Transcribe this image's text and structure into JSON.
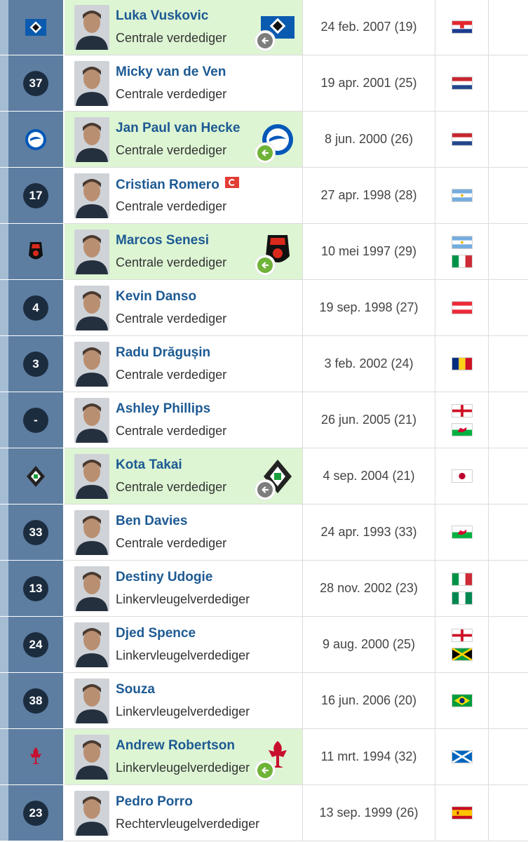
{
  "players": [
    {
      "num": "",
      "club_badge": "hamburg-badge",
      "name": "Luka Vuskovic",
      "position": "Centrale verdediger",
      "dob": "24 feb. 2007 (19)",
      "flags": [
        "croatia-flag"
      ],
      "loan": true,
      "loan_club": "hamburg-logo",
      "loan_arrow": "gray"
    },
    {
      "num": "37",
      "club_badge": "",
      "name": "Micky van de Ven",
      "position": "Centrale verdediger",
      "dob": "19 apr. 2001 (25)",
      "flags": [
        "netherlands-flag"
      ],
      "loan": false
    },
    {
      "num": "",
      "club_badge": "brighton-badge",
      "name": "Jan Paul van Hecke",
      "position": "Centrale verdediger",
      "dob": "8 jun. 2000 (26)",
      "flags": [
        "netherlands-flag"
      ],
      "loan": true,
      "loan_club": "brighton-logo",
      "loan_arrow": "green"
    },
    {
      "num": "17",
      "club_badge": "",
      "name": "Cristian Romero",
      "position": "Centrale verdediger",
      "dob": "27 apr. 1998 (28)",
      "flags": [
        "argentina-flag"
      ],
      "loan": false,
      "captain": true
    },
    {
      "num": "",
      "club_badge": "bournemouth-badge",
      "name": "Marcos Senesi",
      "position": "Centrale verdediger",
      "dob": "10 mei 1997 (29)",
      "flags": [
        "argentina-flag",
        "italy-flag"
      ],
      "loan": true,
      "loan_club": "bournemouth-logo",
      "loan_arrow": "green"
    },
    {
      "num": "4",
      "club_badge": "",
      "name": "Kevin Danso",
      "position": "Centrale verdediger",
      "dob": "19 sep. 1998 (27)",
      "flags": [
        "austria-flag"
      ],
      "loan": false
    },
    {
      "num": "3",
      "club_badge": "",
      "name": "Radu Drăgușin",
      "position": "Centrale verdediger",
      "dob": "3 feb. 2002 (24)",
      "flags": [
        "romania-flag"
      ],
      "loan": false
    },
    {
      "num": "-",
      "club_badge": "",
      "name": "Ashley Phillips",
      "position": "Centrale verdediger",
      "dob": "26 jun. 2005 (21)",
      "flags": [
        "england-flag",
        "wales-flag"
      ],
      "loan": false
    },
    {
      "num": "",
      "club_badge": "gladbach-badge",
      "name": "Kota Takai",
      "position": "Centrale verdediger",
      "dob": "4 sep. 2004 (21)",
      "flags": [
        "japan-flag"
      ],
      "loan": true,
      "loan_club": "gladbach-logo",
      "loan_arrow": "gray"
    },
    {
      "num": "33",
      "club_badge": "",
      "name": "Ben Davies",
      "position": "Centrale verdediger",
      "dob": "24 apr. 1993 (33)",
      "flags": [
        "wales-flag"
      ],
      "loan": false
    },
    {
      "num": "13",
      "club_badge": "",
      "name": "Destiny Udogie",
      "position": "Linkervleugelverdediger",
      "dob": "28 nov. 2002 (23)",
      "flags": [
        "italy-flag",
        "nigeria-flag"
      ],
      "loan": false
    },
    {
      "num": "24",
      "club_badge": "",
      "name": "Djed Spence",
      "position": "Linkervleugelverdediger",
      "dob": "9 aug. 2000 (25)",
      "flags": [
        "england-flag",
        "jamaica-flag"
      ],
      "loan": false
    },
    {
      "num": "38",
      "club_badge": "",
      "name": "Souza",
      "position": "Linkervleugelverdediger",
      "dob": "16 jun. 2006 (20)",
      "flags": [
        "brazil-flag"
      ],
      "loan": false
    },
    {
      "num": "",
      "club_badge": "liverpool-badge",
      "name": "Andrew Robertson",
      "position": "Linkervleugelverdediger",
      "dob": "11 mrt. 1994 (32)",
      "flags": [
        "scotland-flag"
      ],
      "loan": true,
      "loan_club": "liverpool-logo",
      "loan_arrow": "green"
    },
    {
      "num": "23",
      "club_badge": "",
      "name": "Pedro Porro",
      "position": "Rechtervleugelverdediger",
      "dob": "13 sep. 1999 (26)",
      "flags": [
        "spain-flag"
      ],
      "loan": false
    }
  ],
  "colors": {
    "num_cell_bg": "#5d7ea1",
    "stripe_bg": "#a5bdd3",
    "badge_bg": "#1c2c3f",
    "loan_row_bg": "#ddf5d3",
    "name_link": "#1d5a93",
    "arrow_green": "#6fb338",
    "arrow_gray": "#7d7d7d"
  }
}
